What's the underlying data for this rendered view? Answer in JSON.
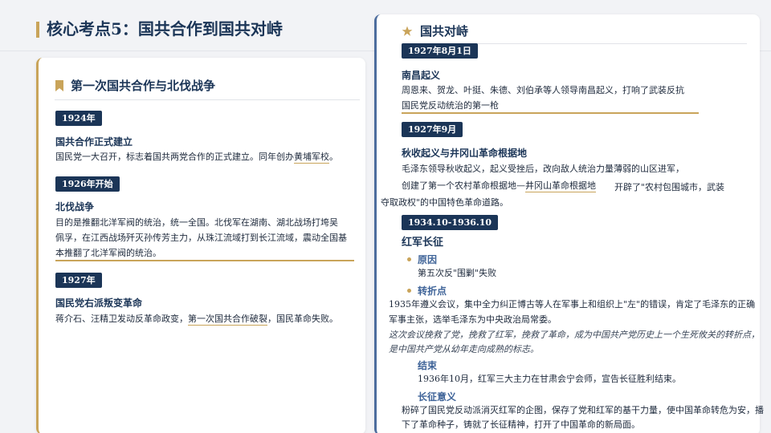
{
  "page": {
    "title": "核心考点5：国共合作到国共对峙"
  },
  "left": {
    "heading": "第一次国共合作与北伐战争",
    "items": [
      {
        "badge": "1924年",
        "title": "国共合作正式建立",
        "lines": [
          "国民党一大召开，标志着国共两党合作的正式建立。同年创办",
          "黄埔军校",
          "。"
        ]
      },
      {
        "badge": "1926年开始",
        "title": "北伐战争",
        "lines": [
          "目的是推翻北洋军阀的统治，统一全国。北伐军在湖南、湖北战场打垮吴",
          "佩孚，在江西战场歼灭孙传芳主力，从珠江流域打到长江流域，震动全国基",
          "本推翻了北洋军阀的统治。"
        ]
      },
      {
        "badge": "1927年",
        "title": "国民党右派叛变革命",
        "lines": [
          "蒋介石、汪精卫发动反革命政变，",
          "第一次国共合作破裂",
          "，国民革命失败。"
        ]
      }
    ]
  },
  "right": {
    "heading": "国共对峙",
    "items": [
      {
        "badge": "1927年8月1日",
        "title": "南昌起义",
        "lines": [
          "周恩来、贺龙、叶挺、朱德、刘伯承等人领导南昌起义，打响了武装反抗",
          "国民党反动统治的第一枪"
        ]
      },
      {
        "badge": "1927年9月",
        "title": "秋收起义与井冈山革命根据地",
        "lines": [
          "毛泽东领导秋收起义，起义受挫后，改向敌人统治力量薄弱的山区进军，",
          "创建了第一个农村革命根据地—",
          "井冈山革命根据地",
          "开辟了\"农村包围城市，武装",
          "夺取政权\"的中国特色革命道路。"
        ]
      },
      {
        "badge": "1934.10-1936.10",
        "title": "红军长征",
        "reason_label": "原因",
        "reason_text": "第五次反\"围剿\"失败",
        "turn_label": "转折点",
        "turn_lines": [
          "1935年遵义会议，集中全力纠正博古等人在军事上和组织上\"左\"的错误，肯定了毛泽东的正确",
          "军事主张，选举毛泽东为中央政治局常委。"
        ],
        "turn_italic": [
          "这次会议挽救了党，挽救了红军，挽救了革命，成为中国共产党历史上一个生死攸关的转折点，",
          "是中国共产党从幼年走向成熟的标志。"
        ],
        "end_label": "结束",
        "end_text": "1936年10月，红军三大主力在甘肃会宁会师，宣告长征胜利结束。",
        "meaning_label": "长征意义",
        "meaning_lines": [
          "粉碎了国民党反动派消灭红军的企图，保存了党和红军的基干力量，使中国革命转危为安，播",
          "下了革命种子，铸就了长征精神，打开了中国革命的新局面。"
        ]
      }
    ]
  }
}
